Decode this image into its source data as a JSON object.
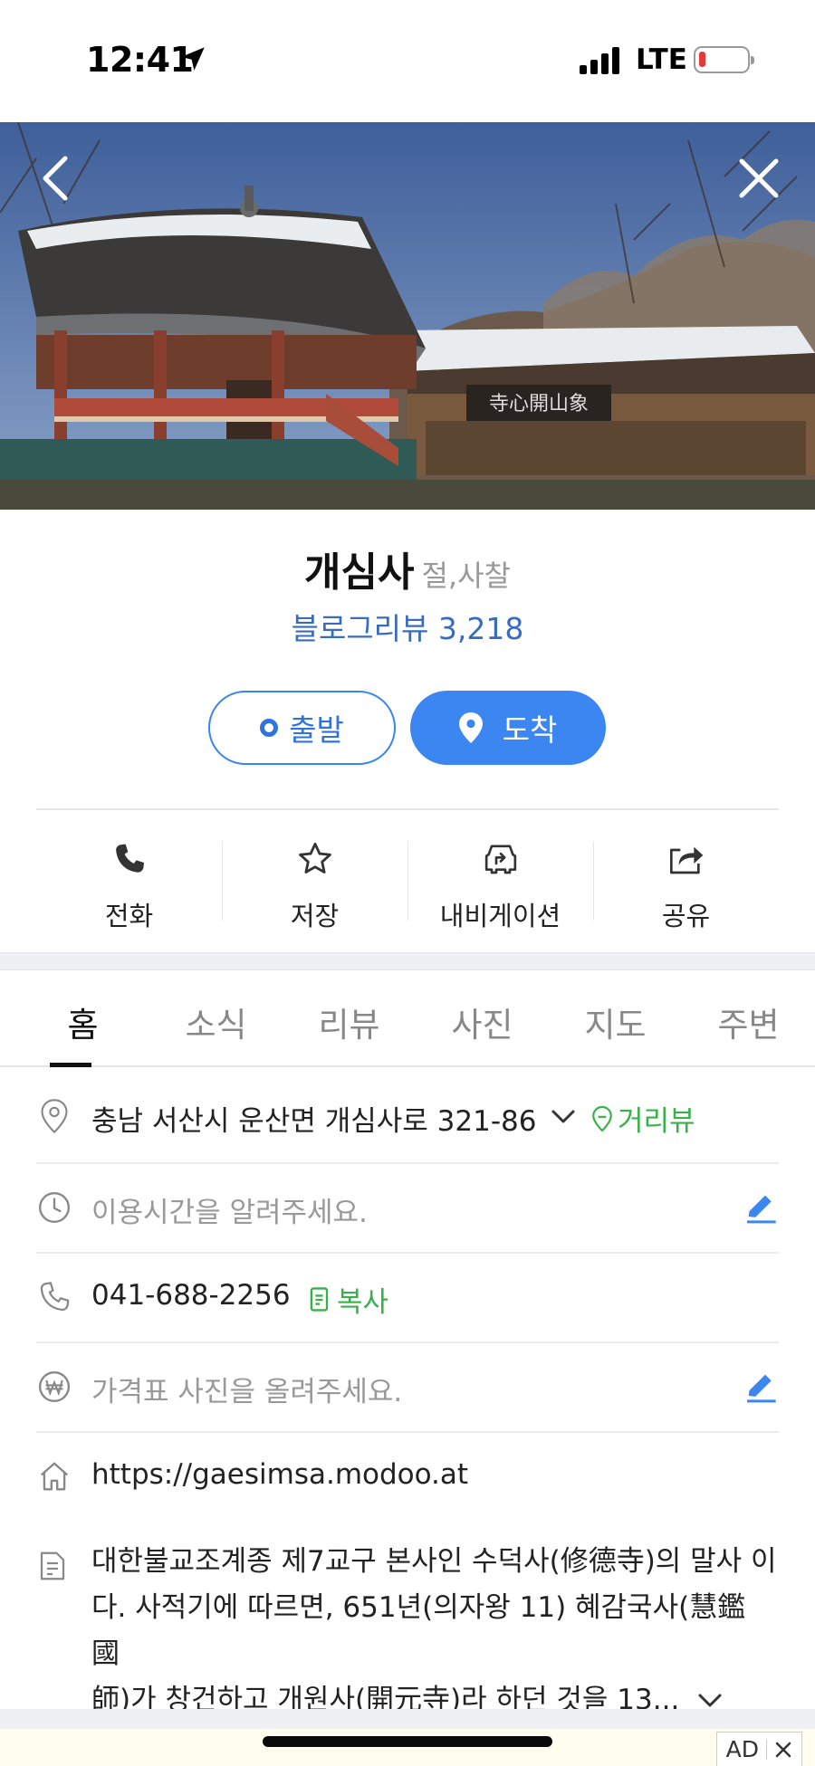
{
  "status_bar": {
    "time": "12:41",
    "network": "LTE",
    "battery_level": 0.1,
    "icons": [
      "location-arrow-icon",
      "signal-icon",
      "battery-icon"
    ]
  },
  "header": {
    "back_icon": "back-icon",
    "close_icon": "close-icon"
  },
  "place": {
    "name": "개심사",
    "category": "절,사찰",
    "blog_review_label": "블로그리뷰",
    "blog_review_count": "3,218"
  },
  "direction": {
    "start_label": "출발",
    "arrive_label": "도착"
  },
  "actions": [
    {
      "label": "전화",
      "icon": "phone-icon"
    },
    {
      "label": "저장",
      "icon": "star-icon"
    },
    {
      "label": "내비게이션",
      "icon": "navigation-icon"
    },
    {
      "label": "공유",
      "icon": "share-icon"
    }
  ],
  "tabs": [
    "홈",
    "소식",
    "리뷰",
    "사진",
    "지도",
    "주변"
  ],
  "active_tab": "홈",
  "info": {
    "address": "충남 서산시 운산면 개심사로 321-86",
    "street_view_label": "거리뷰",
    "hours_placeholder": "이용시간을 알려주세요.",
    "phone": "041-688-2256",
    "copy_label": "복사",
    "price_placeholder": "가격표 사진을 올려주세요.",
    "website": "https://gaesimsa.modoo.at",
    "description_line1": "대한불교조계종 제7교구 본사인 수덕사(修德寺)의 말사 이",
    "description_line2": "다. 사적기에 따르면, 651년(의자왕 11) 혜감국사(慧鑑 國",
    "description_line3": "師)가 창건하고 개원사(開元寺)라 하던 것을 13..."
  },
  "ad": {
    "label": "AD",
    "close_icon": "close-icon"
  },
  "colors": {
    "accent_blue": "#3b86f0",
    "link_blue": "#3a6cbd",
    "green": "#38b149"
  }
}
